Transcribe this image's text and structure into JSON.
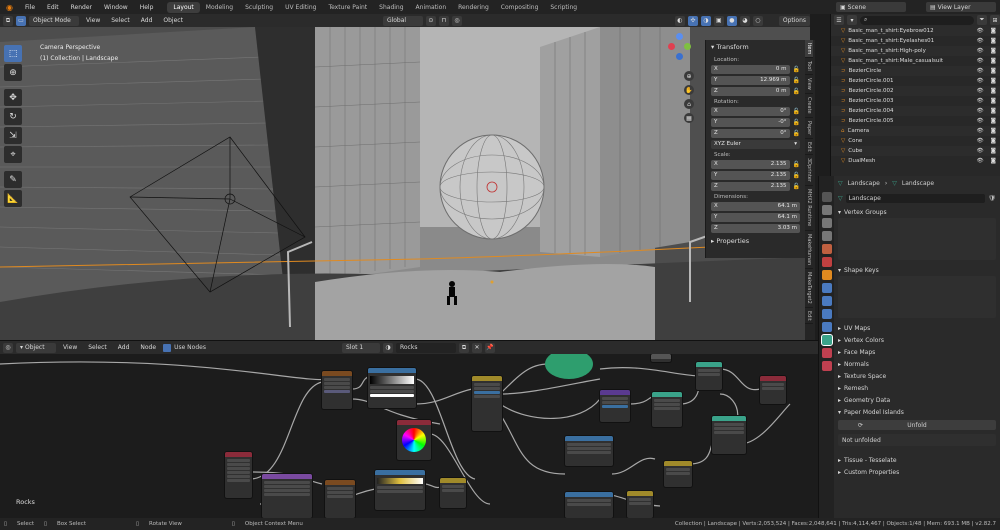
{
  "topbar": {
    "menus": [
      "File",
      "Edit",
      "Render",
      "Window",
      "Help"
    ],
    "workspaces": [
      "Layout",
      "Modeling",
      "Sculpting",
      "UV Editing",
      "Texture Paint",
      "Shading",
      "Animation",
      "Rendering",
      "Compositing",
      "Scripting"
    ],
    "active_workspace": "Layout",
    "scene": "Scene",
    "view_layer": "View Layer"
  },
  "viewport_header": {
    "mode": "Object Mode",
    "menus": [
      "View",
      "Select",
      "Add",
      "Object"
    ],
    "transform_orientation": "Global",
    "options": "Options"
  },
  "viewport": {
    "camera_label": "Camera Perspective",
    "collection_label": "(1) Collection | Landscape"
  },
  "transform_panel": {
    "title": "Transform",
    "location_label": "Location:",
    "location": [
      {
        "axis": "X",
        "value": "0 m"
      },
      {
        "axis": "Y",
        "value": "12.969 m"
      },
      {
        "axis": "Z",
        "value": "0 m"
      }
    ],
    "rotation_label": "Rotation:",
    "rotation": [
      {
        "axis": "X",
        "value": "0°"
      },
      {
        "axis": "Y",
        "value": "-0°"
      },
      {
        "axis": "Z",
        "value": "0°"
      }
    ],
    "rotation_mode": "XYZ Euler",
    "scale_label": "Scale:",
    "scale": [
      {
        "axis": "X",
        "value": "2.135"
      },
      {
        "axis": "Y",
        "value": "2.135"
      },
      {
        "axis": "Z",
        "value": "2.135"
      }
    ],
    "dimensions_label": "Dimensions:",
    "dimensions": [
      {
        "axis": "X",
        "value": "64.1 m"
      },
      {
        "axis": "Y",
        "value": "64.1 m"
      },
      {
        "axis": "Z",
        "value": "3.03 m"
      }
    ],
    "properties_label": "Properties"
  },
  "sidebar_tabs": [
    "Item",
    "Tool",
    "View",
    "Create",
    "Paper",
    "Edit",
    "3Dprinter",
    "MHX2 Runtime",
    "MakeHuman",
    "MakeTarget2",
    "Edit"
  ],
  "node_editor_header": {
    "type": "Object",
    "menus": [
      "View",
      "Select",
      "Add",
      "Node"
    ],
    "use_nodes": "Use Nodes",
    "slot": "Slot 1",
    "material": "Rocks"
  },
  "node_editor": {
    "material_label": "Rocks"
  },
  "outliner": {
    "items": [
      {
        "name": "Basic_man_t_shirt:Eyebrow012",
        "icon": "mesh-icon"
      },
      {
        "name": "Basic_man_t_shirt:Eyelashes01",
        "icon": "mesh-icon"
      },
      {
        "name": "Basic_man_t_shirt:High-poly",
        "icon": "mesh-icon"
      },
      {
        "name": "Basic_man_t_shirt:Male_casualsuit",
        "icon": "mesh-icon"
      },
      {
        "name": "BezierCircle",
        "icon": "curve-icon"
      },
      {
        "name": "BezierCircle.001",
        "icon": "curve-icon"
      },
      {
        "name": "BezierCircle.002",
        "icon": "curve-icon"
      },
      {
        "name": "BezierCircle.003",
        "icon": "curve-icon"
      },
      {
        "name": "BezierCircle.004",
        "icon": "curve-icon"
      },
      {
        "name": "BezierCircle.005",
        "icon": "curve-icon"
      },
      {
        "name": "Camera",
        "icon": "camera-icon"
      },
      {
        "name": "Cone",
        "icon": "mesh-icon"
      },
      {
        "name": "Cube",
        "icon": "mesh-icon"
      },
      {
        "name": "DualMesh",
        "icon": "mesh-icon"
      }
    ]
  },
  "properties": {
    "object_name": "Landscape",
    "data_name": "Landscape",
    "mesh_name": "Landscape",
    "sections": {
      "vertex_groups": "Vertex Groups",
      "shape_keys": "Shape Keys",
      "uv_maps": "UV Maps",
      "vertex_colors": "Vertex Colors",
      "face_maps": "Face Maps",
      "normals": "Normals",
      "texture_space": "Texture Space",
      "remesh": "Remesh",
      "geometry_data": "Geometry Data",
      "paper_model": "Paper Model Islands",
      "tissue": "Tissue - Tesselate",
      "custom_props": "Custom Properties"
    },
    "unfold_button": "Unfold",
    "not_unfolded": "Not unfolded"
  },
  "statusbar": {
    "select": "Select",
    "box_select": "Box Select",
    "rotate_view": "Rotate View",
    "context_menu": "Object Context Menu",
    "stats": "Collection | Landscape | Verts:2,053,524 | Faces:2,048,641 | Tris:4,114,467 | Objects:1/48 | Mem: 693.1 MB | v2.82.7"
  },
  "colors": {
    "accent": "#4772b3",
    "node_green": "#2e9e6e",
    "node_teal": "#3aa38a"
  }
}
